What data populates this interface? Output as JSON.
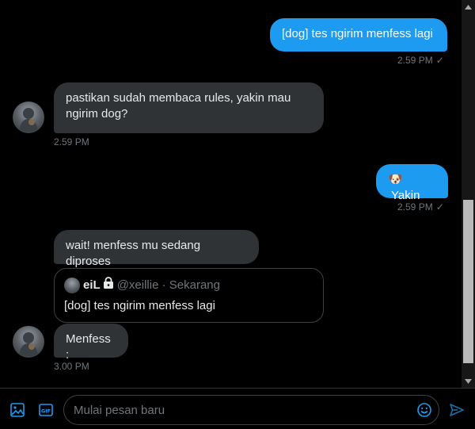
{
  "messages": {
    "m1": {
      "text": "[dog] tes ngirim menfess lagi",
      "time": "2.59 PM",
      "status": "✓"
    },
    "m2": {
      "text": "pastikan sudah membaca rules, yakin mau ngirim dog?",
      "time": "2.59 PM"
    },
    "m3": {
      "emoji": "🐶",
      "text": "Yakin",
      "time": "2.59 PM",
      "status": "✓"
    },
    "m4": {
      "text": "wait! menfess mu sedang diproses"
    },
    "quote": {
      "name": "eiL",
      "handle": "@xeillie · Sekarang",
      "text": "[dog] tes ngirim menfess lagi"
    },
    "m5": {
      "text": "Menfess :",
      "time": "3.00 PM"
    }
  },
  "composer": {
    "placeholder": "Mulai pesan baru",
    "gif_label": "GIF"
  },
  "colors": {
    "accent": "#1d9bf0",
    "bubble_received": "#2f3336",
    "muted": "#71767b"
  },
  "icons": [
    "image-icon",
    "gif-icon",
    "emoji-icon",
    "send-icon",
    "lock-icon",
    "check-icon"
  ]
}
